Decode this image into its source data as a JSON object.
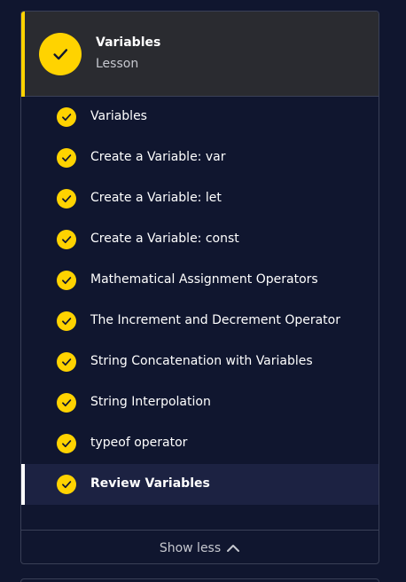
{
  "module": {
    "title": "Variables",
    "subtitle": "Lesson"
  },
  "items": [
    {
      "label": "Variables",
      "completed": true
    },
    {
      "label": "Create a Variable: var",
      "completed": true
    },
    {
      "label": "Create a Variable: let",
      "completed": true
    },
    {
      "label": "Create a Variable: const",
      "completed": true
    },
    {
      "label": "Mathematical Assignment Operators",
      "completed": true
    },
    {
      "label": "The Increment and Decrement Operator",
      "completed": true
    },
    {
      "label": "String Concatenation with Variables",
      "completed": true
    },
    {
      "label": "String Interpolation",
      "completed": true
    },
    {
      "label": "typeof operator",
      "completed": true
    },
    {
      "label": "Review Variables",
      "completed": true,
      "active": true
    }
  ],
  "footer": {
    "toggle_label": "Show less",
    "toggle_icon": "chevron-up-icon"
  },
  "colors": {
    "accent": "#ffd300",
    "background": "#10162f",
    "header_bg": "#2a2b30",
    "active_bg": "#1c2242"
  }
}
